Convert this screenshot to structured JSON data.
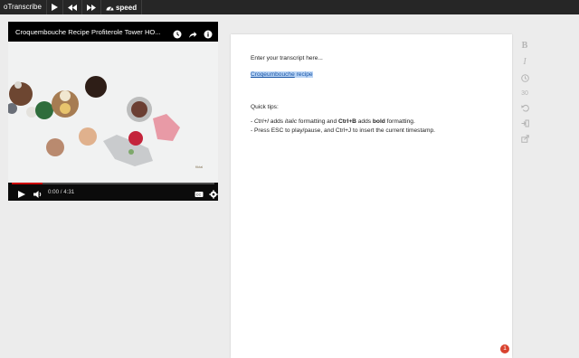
{
  "toolbar": {
    "brand": "oTranscribe",
    "play_icon": "play-icon",
    "rewind_icon": "rewind-icon",
    "ffwd_icon": "fast-forward-icon",
    "speed_label": "speed"
  },
  "video": {
    "title": "Croquembouche Recipe Profiterole Tower HO...",
    "time": "0:00 / 4:31",
    "progress": 0.15,
    "watermark": "fiktal"
  },
  "editor": {
    "placeholder": "Enter your transcript here...",
    "link_text": "Croqeumbouche",
    "link_rest": " recipe",
    "tips_heading": "Quick tips:",
    "tip1_a": "- ",
    "tip1_italic": "Ctrl+I",
    "tip1_b": " adds ",
    "tip1_italic_word": "italic",
    "tip1_c": " formatting and ",
    "tip1_bold": "Ctrl+B",
    "tip1_d": " adds ",
    "tip1_bold_word": "bold",
    "tip1_e": " formatting.",
    "tip2": "- Press ESC to play/pause, and Ctrl+J to insert the current timestamp."
  },
  "side": {
    "bold": "B",
    "italic": "I",
    "seconds": "30"
  },
  "notification_count": "1"
}
